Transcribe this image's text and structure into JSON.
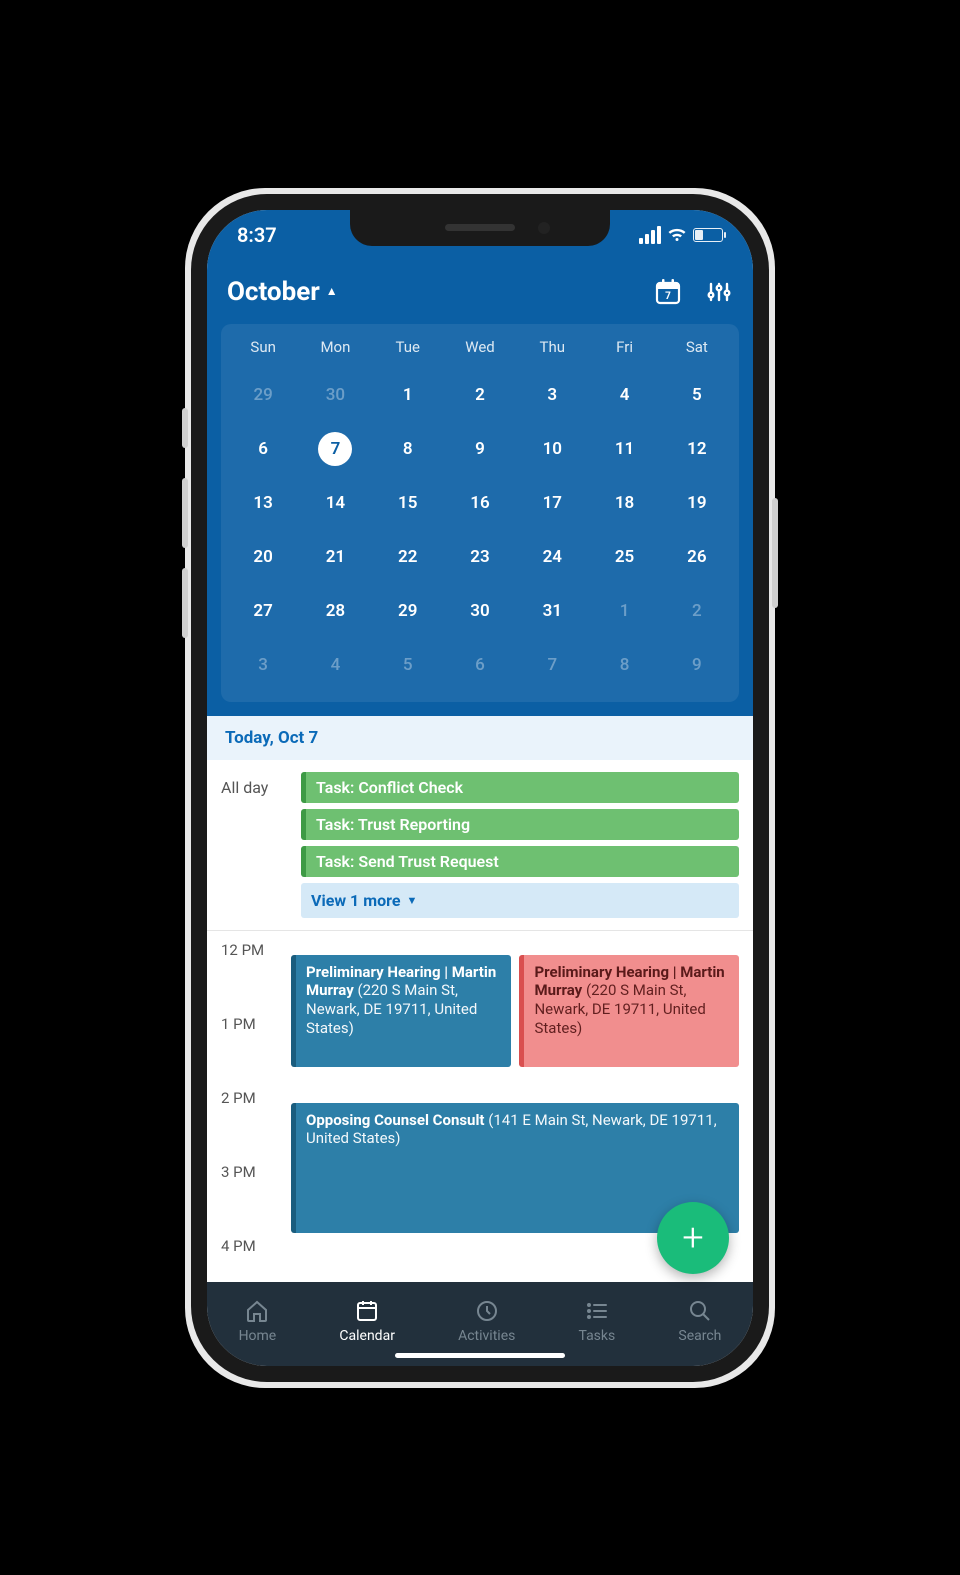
{
  "status": {
    "time": "8:37"
  },
  "header": {
    "month": "October",
    "today_badge": "7"
  },
  "calendar": {
    "dows": [
      "Sun",
      "Mon",
      "Tue",
      "Wed",
      "Thu",
      "Fri",
      "Sat"
    ],
    "weeks": [
      [
        {
          "d": "29",
          "o": true
        },
        {
          "d": "30",
          "o": true
        },
        {
          "d": "1"
        },
        {
          "d": "2"
        },
        {
          "d": "3"
        },
        {
          "d": "4"
        },
        {
          "d": "5"
        }
      ],
      [
        {
          "d": "6"
        },
        {
          "d": "7",
          "sel": true
        },
        {
          "d": "8"
        },
        {
          "d": "9"
        },
        {
          "d": "10"
        },
        {
          "d": "11"
        },
        {
          "d": "12"
        }
      ],
      [
        {
          "d": "13"
        },
        {
          "d": "14"
        },
        {
          "d": "15"
        },
        {
          "d": "16"
        },
        {
          "d": "17"
        },
        {
          "d": "18"
        },
        {
          "d": "19"
        }
      ],
      [
        {
          "d": "20"
        },
        {
          "d": "21"
        },
        {
          "d": "22"
        },
        {
          "d": "23"
        },
        {
          "d": "24"
        },
        {
          "d": "25"
        },
        {
          "d": "26"
        }
      ],
      [
        {
          "d": "27"
        },
        {
          "d": "28"
        },
        {
          "d": "29"
        },
        {
          "d": "30"
        },
        {
          "d": "31"
        },
        {
          "d": "1",
          "o": true
        },
        {
          "d": "2",
          "o": true
        }
      ],
      [
        {
          "d": "3",
          "o": true
        },
        {
          "d": "4",
          "o": true
        },
        {
          "d": "5",
          "o": true
        },
        {
          "d": "6",
          "o": true
        },
        {
          "d": "7",
          "o": true
        },
        {
          "d": "8",
          "o": true
        },
        {
          "d": "9",
          "o": true
        }
      ]
    ]
  },
  "today": {
    "label": "Today, Oct 7"
  },
  "allday": {
    "label": "All day",
    "tasks": [
      "Task: Conflict Check",
      "Task: Trust Reporting",
      "Task: Send Trust Request"
    ],
    "more": "View 1 more"
  },
  "timeline": {
    "hours": [
      "12 PM",
      "1 PM",
      "2 PM",
      "3 PM",
      "4 PM"
    ],
    "events": [
      {
        "title": "Preliminary Hearing | Martin Murray",
        "loc": "(220 S Main St, Newark, DE 19711, United States)"
      },
      {
        "title": "Preliminary Hearing | Martin Murray",
        "loc": "(220 S Main St, Newark, DE 19711, United States)"
      },
      {
        "title": "Opposing Counsel Consult",
        "loc": "(141 E Main St, Newark, DE 19711, United States)"
      }
    ]
  },
  "tabs": [
    "Home",
    "Calendar",
    "Activities",
    "Tasks",
    "Search"
  ],
  "colors": {
    "brandBlue": "#0b5fa4",
    "taskGreen": "#6ec071",
    "eventTeal": "#2d7fa8",
    "eventPink": "#f18e8e",
    "fab": "#1abc7a"
  }
}
